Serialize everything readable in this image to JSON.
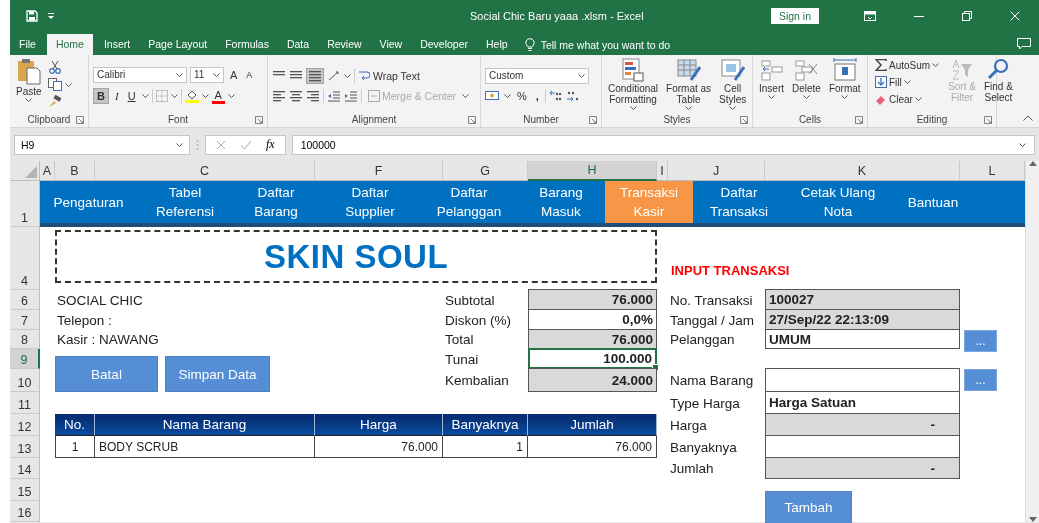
{
  "window": {
    "title": "Social Chic Baru yaaa .xlsm  -  Excel",
    "sign_in": "Sign in"
  },
  "menu_tabs": [
    {
      "label": "File",
      "selected": false
    },
    {
      "label": "Home",
      "selected": true
    },
    {
      "label": "Insert",
      "selected": false
    },
    {
      "label": "Page Layout",
      "selected": false
    },
    {
      "label": "Formulas",
      "selected": false
    },
    {
      "label": "Data",
      "selected": false
    },
    {
      "label": "Review",
      "selected": false
    },
    {
      "label": "View",
      "selected": false
    },
    {
      "label": "Developer",
      "selected": false
    },
    {
      "label": "Help",
      "selected": false
    }
  ],
  "tell_me": "Tell me what you want to do",
  "ribbon": {
    "clipboard": {
      "label": "Clipboard",
      "paste": "Paste"
    },
    "font": {
      "label": "Font",
      "family": "Calibri",
      "size": "11",
      "grow": "A",
      "shrink": "A",
      "buttons": [
        {
          "label": "B",
          "selected": true
        },
        {
          "label": "I",
          "selected": false
        },
        {
          "label": "U",
          "selected": false
        }
      ],
      "color_button": "A"
    },
    "alignment": {
      "label": "Alignment",
      "wrap_text": "Wrap Text",
      "merge_center": {
        "label": "Merge & Center",
        "disabled": true
      }
    },
    "number": {
      "label": "Number",
      "format": "Custom",
      "percent": "%",
      "comma": ","
    },
    "styles": {
      "label": "Styles",
      "buttons": [
        "Conditional\nFormatting",
        "Format as\nTable",
        "Cell\nStyles"
      ]
    },
    "cells": {
      "label": "Cells",
      "buttons": [
        "Insert",
        "Delete",
        "Format"
      ]
    },
    "editing": {
      "label": "Editing",
      "small": [
        "AutoSum",
        "Fill",
        "Clear"
      ],
      "large": [
        {
          "label": "Sort &\nFilter",
          "disabled": true
        },
        {
          "label": "Find &\nSelect",
          "disabled": false
        }
      ]
    }
  },
  "formula_bar": {
    "name_box": "H9",
    "fx": "fx",
    "value": "100000"
  },
  "sheet": {
    "columns": [
      {
        "label": "A",
        "selected": false
      },
      {
        "label": "B",
        "selected": false
      },
      {
        "label": "C",
        "selected": false
      },
      {
        "label": "F",
        "selected": false
      },
      {
        "label": "G",
        "selected": false
      },
      {
        "label": "H",
        "selected": true
      },
      {
        "label": "I",
        "selected": false
      },
      {
        "label": "J",
        "selected": false
      },
      {
        "label": "K",
        "selected": false
      },
      {
        "label": "L",
        "selected": false
      }
    ],
    "rows": [
      {
        "label": "1",
        "selected": false
      },
      {
        "label": "4",
        "selected": false
      },
      {
        "label": "6",
        "selected": false
      },
      {
        "label": "7",
        "selected": false
      },
      {
        "label": "8",
        "selected": false
      },
      {
        "label": "9",
        "selected": true
      },
      {
        "label": "10",
        "selected": false
      },
      {
        "label": "11",
        "selected": false
      },
      {
        "label": "12",
        "selected": false
      },
      {
        "label": "13",
        "selected": false
      },
      {
        "label": "14",
        "selected": false
      },
      {
        "label": "15",
        "selected": false
      },
      {
        "label": "16",
        "selected": false
      }
    ]
  },
  "nav": [
    {
      "label": "Pengaturan",
      "selected": false
    },
    {
      "label": "Tabel\nReferensi",
      "selected": false
    },
    {
      "label": "Daftar\nBarang",
      "selected": false
    },
    {
      "label": "Daftar\nSupplier",
      "selected": false
    },
    {
      "label": "Daftar\nPelanggan",
      "selected": false
    },
    {
      "label": "Barang\nMasuk",
      "selected": false
    },
    {
      "label": "Transaksi\nKasir",
      "selected": true
    },
    {
      "label": "Daftar\nTransaksi",
      "selected": false
    },
    {
      "label": "Cetak Ulang\nNota",
      "selected": false
    },
    {
      "label": "Bantuan",
      "selected": false
    }
  ],
  "logo": "SKIN SOUL",
  "store": [
    "SOCIAL CHIC",
    "Telepon :",
    "Kasir : NAWANG"
  ],
  "actions": [
    "Batal",
    "Simpan Data"
  ],
  "summary": [
    {
      "label": "Subtotal",
      "value": "76.000",
      "readonly": true,
      "selected": false
    },
    {
      "label": "Diskon (%)",
      "value": "0,0%",
      "readonly": false,
      "selected": false
    },
    {
      "label": "Total",
      "value": "76.000",
      "readonly": true,
      "selected": false
    },
    {
      "label": "Tunai",
      "value": "100.000",
      "readonly": false,
      "selected": true
    },
    {
      "label": "Kembalian",
      "value": "24.000",
      "readonly": true,
      "selected": false
    }
  ],
  "items_table": {
    "columns": [
      "No.",
      "Nama Barang",
      "Harga",
      "Banyaknya",
      "Jumlah"
    ],
    "rows": [
      [
        "1",
        "BODY SCRUB",
        "76.000",
        "1",
        "76.000"
      ]
    ]
  },
  "input_form": {
    "title": "INPUT TRANSAKSI",
    "fields": [
      {
        "label": "No. Transaksi",
        "value": "100027",
        "readonly": true,
        "kind": "text"
      },
      {
        "label": "Tanggal / Jam",
        "value": "27/Sep/22 22:13:09",
        "readonly": true,
        "kind": "text"
      },
      {
        "label": "Pelanggan",
        "value": "UMUM",
        "readonly": false,
        "kind": "text",
        "button": "..."
      },
      {
        "label": "Nama Barang",
        "readonly": false,
        "kind": "text",
        "button": "..."
      },
      {
        "label": "Type Harga",
        "value": "Harga Satuan",
        "readonly": false,
        "kind": "text"
      },
      {
        "label": "Harga",
        "value": "-",
        "readonly": true,
        "kind": "number"
      },
      {
        "label": "Banyaknya",
        "readonly": false,
        "kind": "number"
      },
      {
        "label": "Jumlah",
        "value": "-",
        "readonly": true,
        "kind": "number"
      }
    ],
    "submit": "Tambah"
  }
}
